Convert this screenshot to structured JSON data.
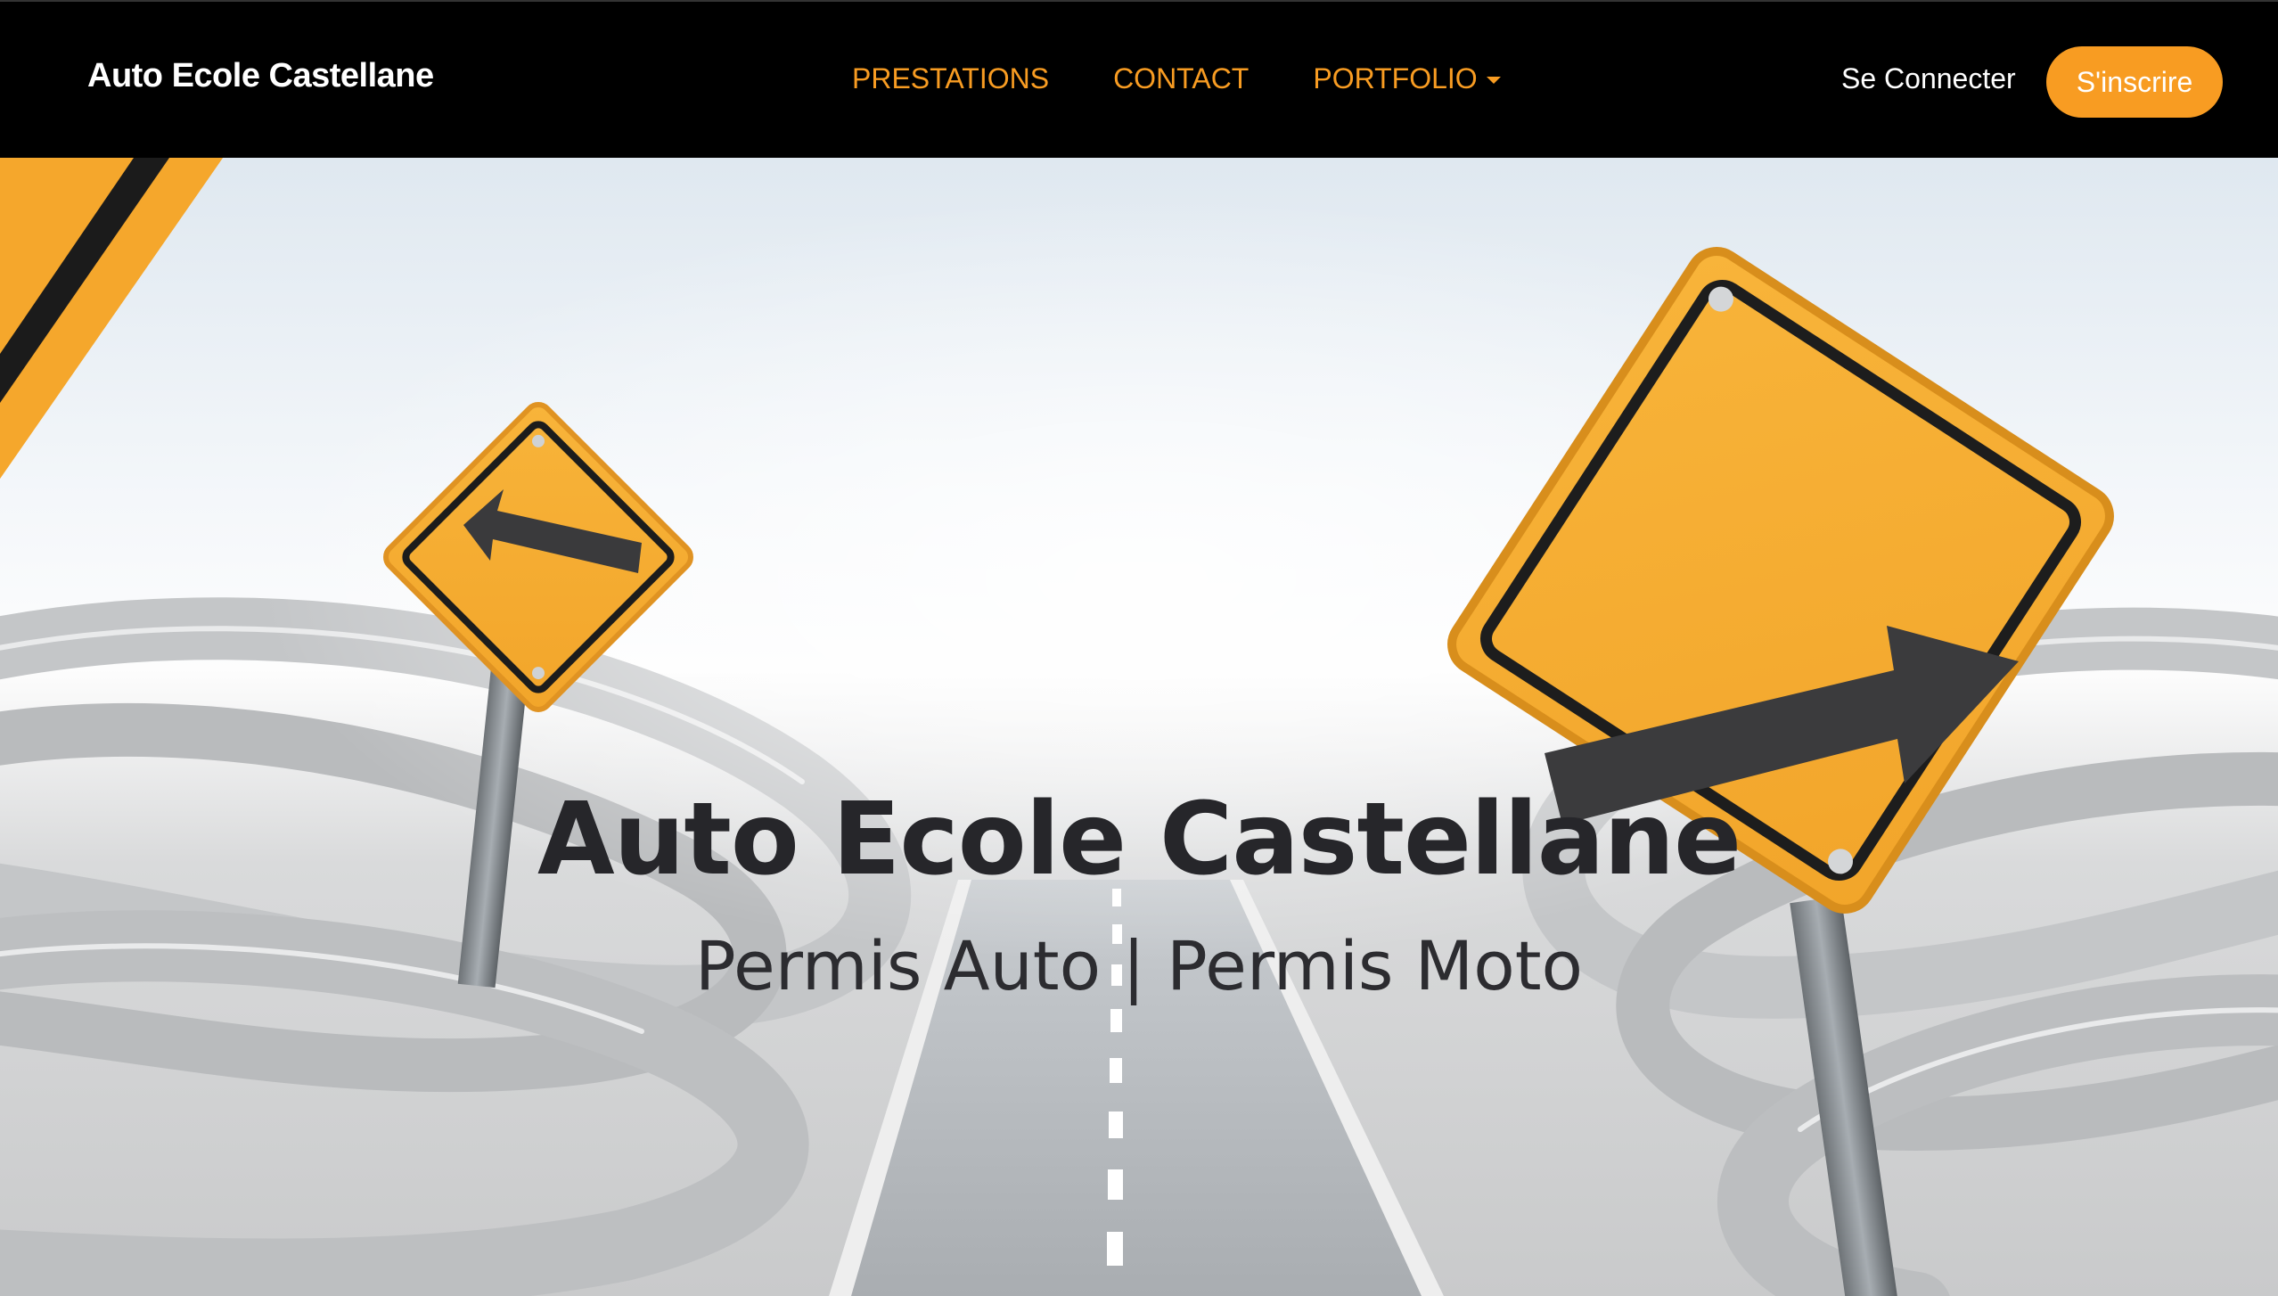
{
  "navbar": {
    "brand": "Auto Ecole Castellane",
    "links": [
      {
        "label": "PRESTATIONS"
      },
      {
        "label": "CONTACT"
      },
      {
        "label": "PORTFOLIO"
      }
    ],
    "login_label": "Se Connecter",
    "signup_label": "S'inscrire"
  },
  "hero": {
    "title": "Auto Ecole Castellane",
    "subtitle": "Permis Auto | Permis Moto",
    "background_icons": [
      "warning-sign-left-arrow-icon",
      "warning-sign-right-arrow-icon",
      "road-icon"
    ]
  },
  "colors": {
    "accent": "#f89c22",
    "navbar_bg": "#000000",
    "sign_yellow": "#f6ad2f",
    "text_dark": "#26262a"
  }
}
